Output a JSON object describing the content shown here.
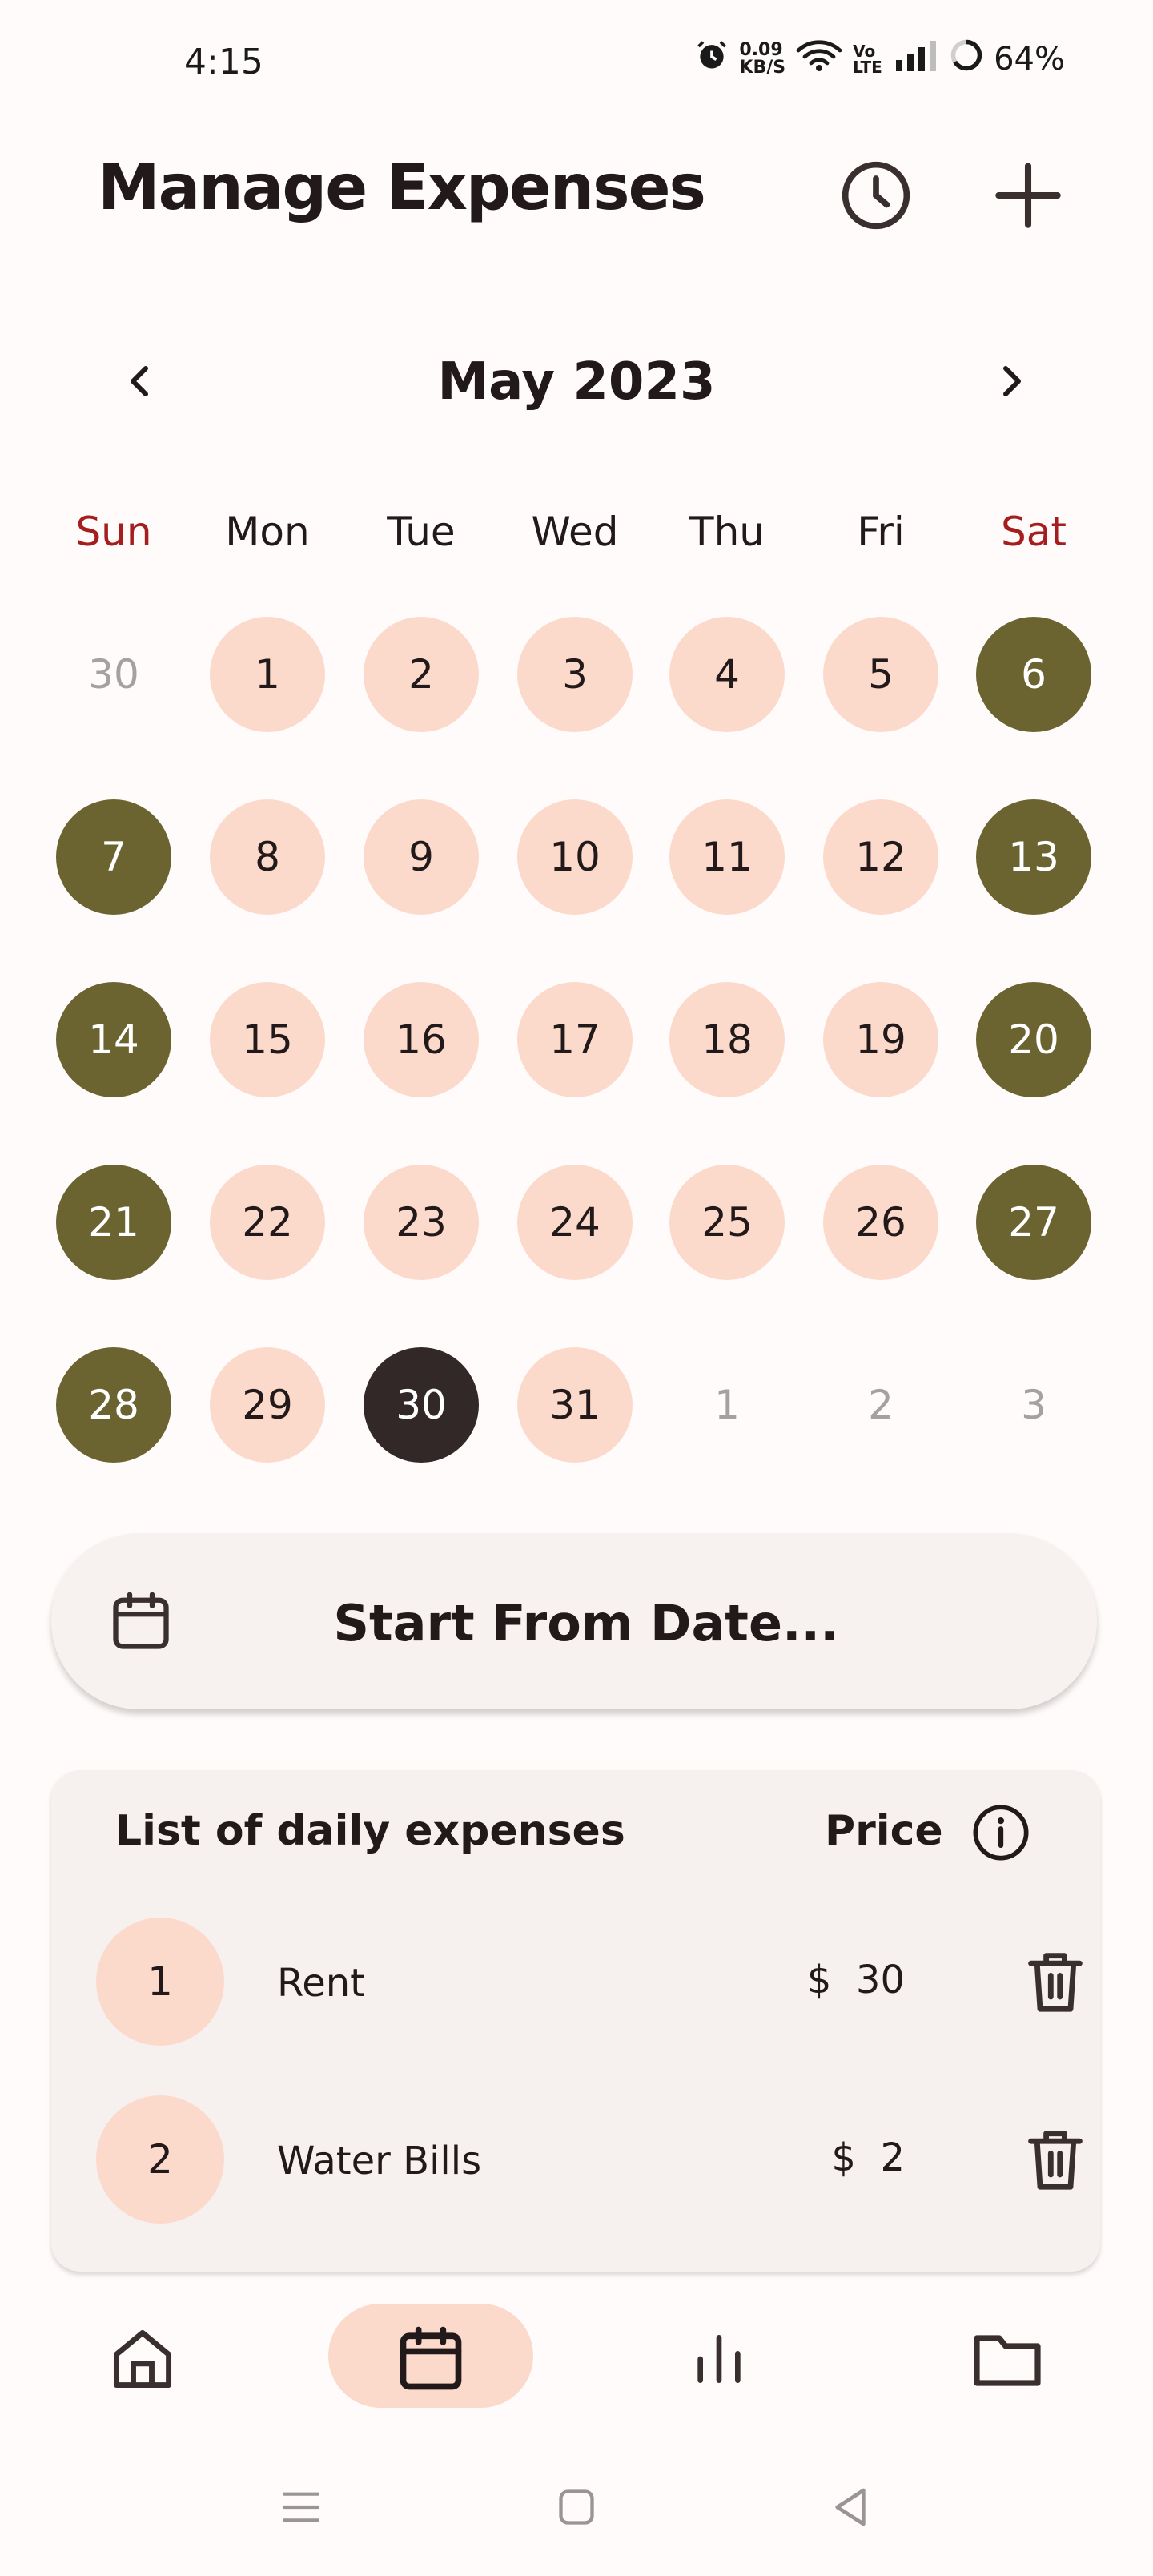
{
  "status_bar": {
    "time": "4:15",
    "speed_value": "0.09",
    "speed_unit": "KB/S",
    "network": "5",
    "volte": "Vo LTE",
    "battery": "64%"
  },
  "header": {
    "title": "Manage Expenses"
  },
  "calendar": {
    "month_label": "May 2023",
    "weekdays": [
      "Sun",
      "Mon",
      "Tue",
      "Wed",
      "Thu",
      "Fri",
      "Sat"
    ],
    "rows": [
      [
        "30",
        "1",
        "2",
        "3",
        "4",
        "5",
        "6"
      ],
      [
        "7",
        "8",
        "9",
        "10",
        "11",
        "12",
        "13"
      ],
      [
        "14",
        "15",
        "16",
        "17",
        "18",
        "19",
        "20"
      ],
      [
        "21",
        "22",
        "23",
        "24",
        "25",
        "26",
        "27"
      ],
      [
        "28",
        "29",
        "30",
        "31",
        "1",
        "2",
        "3"
      ]
    ]
  },
  "start_button": {
    "label": "Start From Date..."
  },
  "expenses": {
    "title": "List of daily expenses",
    "price_header": "Price",
    "items": [
      {
        "index": "1",
        "name": "Rent",
        "price": "$  30"
      },
      {
        "index": "2",
        "name": "Water Bills",
        "price": "$  2"
      }
    ]
  },
  "colors": {
    "background": "#fffbfb",
    "pink": "#fcdacb",
    "olive": "#6b6430",
    "selected": "#322828",
    "weekend_red": "#a41e1e",
    "muted": "#a6a1a1"
  }
}
